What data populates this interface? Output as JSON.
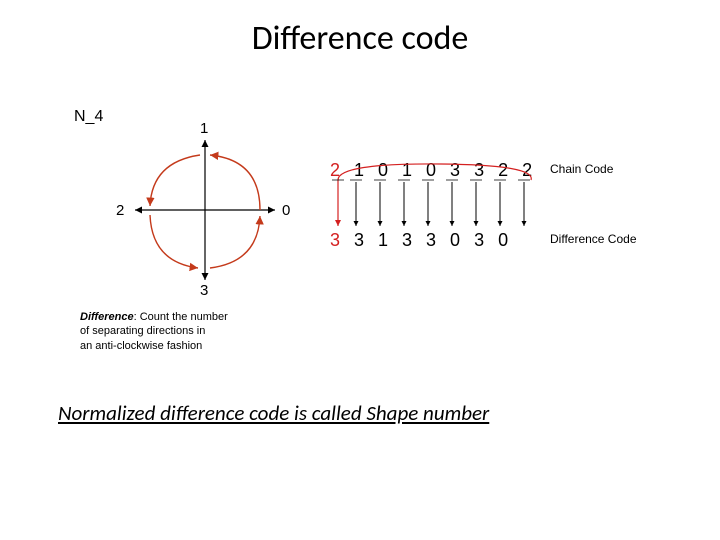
{
  "title": "Difference code",
  "n4": "N_4",
  "dirs": {
    "top": "1",
    "right": "0",
    "bottom": "3",
    "left": "2"
  },
  "diff_explain": {
    "l1": "Difference",
    "l2": ": Count the number",
    "l3": "of separating directions in",
    "l4": "an anti-clockwise fashion"
  },
  "chain_code": {
    "first": "2",
    "rest": "10103322"
  },
  "diff_code": {
    "first": "3",
    "rest": "3133030"
  },
  "labels": {
    "chain": "Chain Code",
    "diff": "Difference Code"
  },
  "summary": "Normalized difference code is called Shape number"
}
